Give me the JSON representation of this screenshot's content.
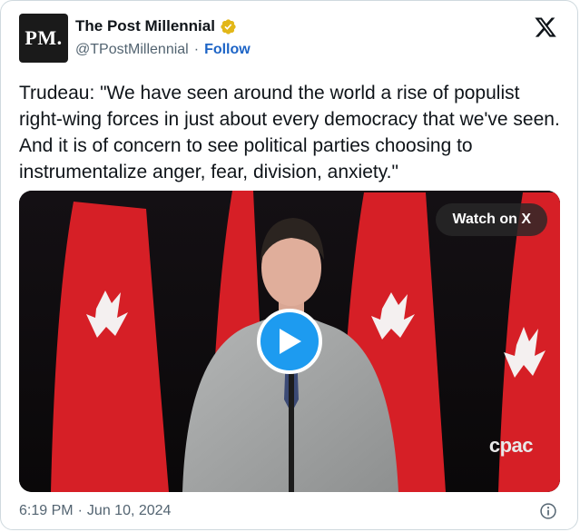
{
  "account": {
    "avatar_text": "PM.",
    "name": "The Post Millennial",
    "handle": "@TPostMillennial",
    "separator": "·",
    "follow_label": "Follow"
  },
  "tweet": {
    "text": "Trudeau: \"We have seen around the world a rise of populist right-wing forces in just about every democracy that we've seen. And it is of concern to see political parties choosing to instrumentalize anger, fear, division, anxiety.\""
  },
  "video": {
    "watch_label": "Watch on X",
    "watermark": "cpac"
  },
  "footer": {
    "time": "6:19 PM",
    "separator": "·",
    "date": "Jun 10, 2024"
  },
  "icons": {
    "verified": "verified-badge-icon",
    "logo": "x-logo-icon",
    "play": "play-icon",
    "info": "info-icon"
  },
  "colors": {
    "link": "#1d64c6",
    "play_button": "#1d9bf0",
    "verified_badge": "#e2b719",
    "flag_red": "#d61f26"
  }
}
